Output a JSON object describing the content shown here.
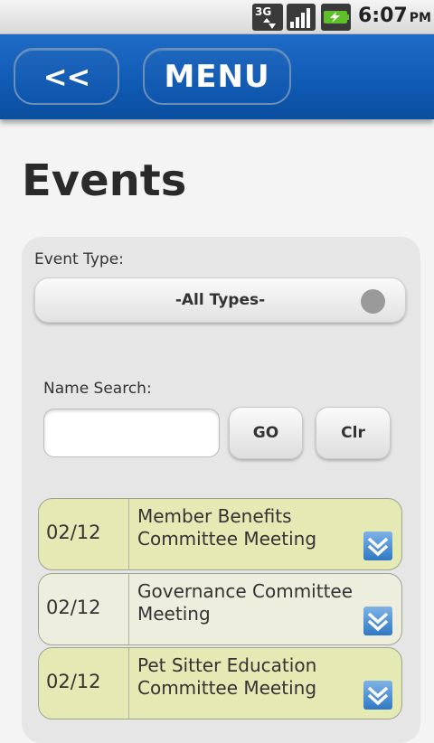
{
  "status_bar": {
    "network": "3G",
    "time": "6:07",
    "ampm": "PM",
    "icons": [
      "3g-data-icon",
      "signal-icon",
      "battery-charging-icon"
    ]
  },
  "header": {
    "back_label": "<<",
    "menu_label": "MENU"
  },
  "page": {
    "title": "Events"
  },
  "filters": {
    "event_type_label": "Event Type:",
    "event_type_value": "-All Types-",
    "name_search_label": "Name Search:",
    "name_search_value": "",
    "go_label": "GO",
    "clear_label": "Clr"
  },
  "events": [
    {
      "date": "02/12",
      "title": "Member Benefits Committee Meeting"
    },
    {
      "date": "02/12",
      "title": "Governance Committee Meeting"
    },
    {
      "date": "02/12",
      "title": "Pet Sitter Education Committee Meeting"
    }
  ],
  "colors": {
    "header_blue": "#0f5ab3",
    "event_odd": "#e5e9b4",
    "event_even": "#eeeedf"
  }
}
